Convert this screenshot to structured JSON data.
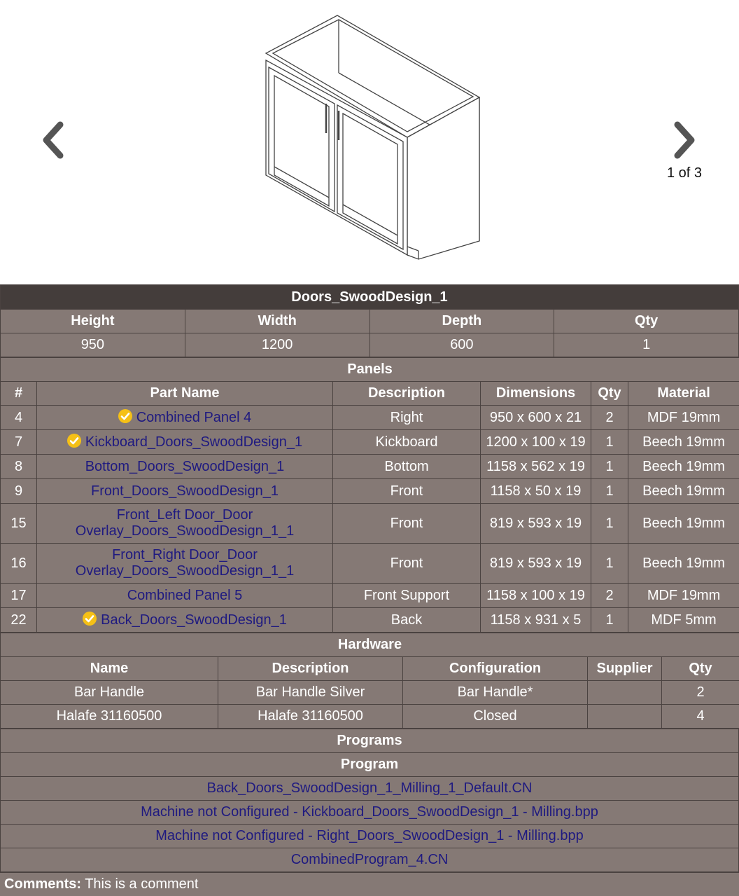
{
  "viewer": {
    "page_indicator": "1 of 3"
  },
  "title": "Doors_SwoodDesign_1",
  "summary": {
    "headers": [
      "Height",
      "Width",
      "Depth",
      "Qty"
    ],
    "values": [
      "950",
      "1200",
      "600",
      "1"
    ]
  },
  "panels": {
    "section_title": "Panels",
    "headers": [
      "#",
      "Part Name",
      "Description",
      "Dimensions",
      "Qty",
      "Material"
    ],
    "rows": [
      {
        "num": "4",
        "name": "Combined Panel 4",
        "check": true,
        "desc": "Right",
        "dims": "950 x 600 x 21",
        "qty": "2",
        "material": "MDF 19mm"
      },
      {
        "num": "7",
        "name": "Kickboard_Doors_SwoodDesign_1",
        "check": true,
        "desc": "Kickboard",
        "dims": "1200 x 100 x 19",
        "qty": "1",
        "material": "Beech 19mm"
      },
      {
        "num": "8",
        "name": "Bottom_Doors_SwoodDesign_1",
        "check": false,
        "desc": "Bottom",
        "dims": "1158 x 562 x 19",
        "qty": "1",
        "material": "Beech 19mm"
      },
      {
        "num": "9",
        "name": "Front_Doors_SwoodDesign_1",
        "check": false,
        "desc": "Front",
        "dims": "1158 x 50 x 19",
        "qty": "1",
        "material": "Beech 19mm"
      },
      {
        "num": "15",
        "name": "Front_Left Door_Door Overlay_Doors_SwoodDesign_1_1",
        "check": false,
        "desc": "Front",
        "dims": "819 x 593 x 19",
        "qty": "1",
        "material": "Beech 19mm"
      },
      {
        "num": "16",
        "name": "Front_Right Door_Door Overlay_Doors_SwoodDesign_1_1",
        "check": false,
        "desc": "Front",
        "dims": "819 x 593 x 19",
        "qty": "1",
        "material": "Beech 19mm"
      },
      {
        "num": "17",
        "name": "Combined Panel 5",
        "check": false,
        "desc": "Front Support",
        "dims": "1158 x 100 x 19",
        "qty": "2",
        "material": "MDF 19mm"
      },
      {
        "num": "22",
        "name": "Back_Doors_SwoodDesign_1",
        "check": true,
        "desc": "Back",
        "dims": "1158 x 931 x 5",
        "qty": "1",
        "material": "MDF 5mm"
      }
    ]
  },
  "hardware": {
    "section_title": "Hardware",
    "headers": [
      "Name",
      "Description",
      "Configuration",
      "Supplier",
      "Qty"
    ],
    "rows": [
      {
        "name": "Bar Handle",
        "desc": "Bar Handle Silver",
        "config": "Bar Handle*",
        "supplier": "",
        "qty": "2"
      },
      {
        "name": "Halafe 31160500",
        "desc": "Halafe 31160500",
        "config": "Closed",
        "supplier": "",
        "qty": "4"
      }
    ]
  },
  "programs": {
    "section_title": "Programs",
    "header": "Program",
    "items": [
      "Back_Doors_SwoodDesign_1_Milling_1_Default.CN",
      "Machine not Configured - Kickboard_Doors_SwoodDesign_1 - Milling.bpp",
      "Machine not Configured - Right_Doors_SwoodDesign_1 - Milling.bpp",
      "CombinedProgram_4.CN"
    ]
  },
  "comments": {
    "label": "Comments:",
    "text": "This is a comment"
  },
  "colors": {
    "table_bg": "#857975",
    "title_bg": "#443d3b",
    "link": "#1f1a80",
    "check": "#f5c016"
  }
}
